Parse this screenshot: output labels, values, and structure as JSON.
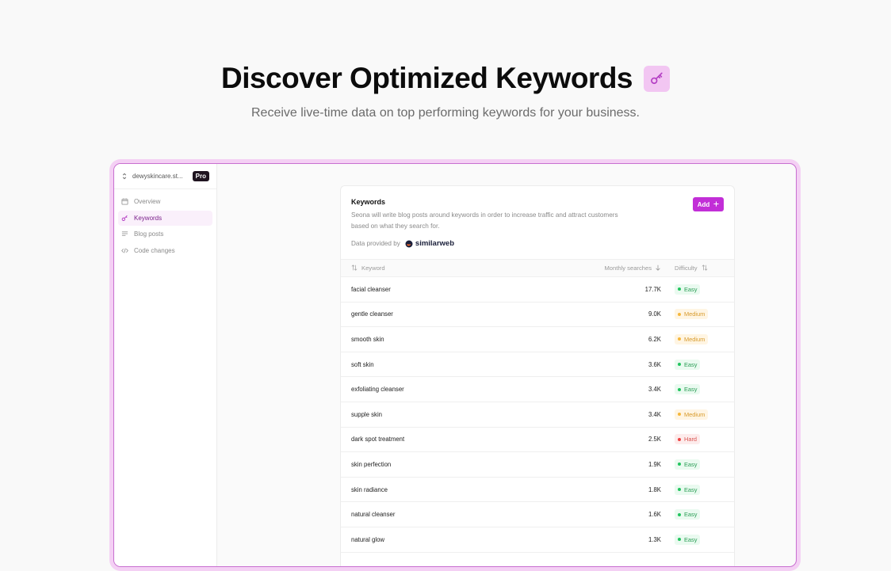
{
  "hero": {
    "title": "Discover Optimized Keywords",
    "subtitle": "Receive live-time data on top performing keywords for your business."
  },
  "sidebar": {
    "workspace": "dewyskincare.st...",
    "plan_badge": "Pro",
    "items": [
      {
        "label": "Overview",
        "icon": "calendar-icon"
      },
      {
        "label": "Keywords",
        "icon": "key-icon",
        "active": true
      },
      {
        "label": "Blog posts",
        "icon": "list-icon"
      },
      {
        "label": "Code changes",
        "icon": "code-icon"
      }
    ]
  },
  "card": {
    "title": "Keywords",
    "description": "Seona will write blog posts around keywords in order to increase traffic and attract customers based on what they search for.",
    "provided_by": "Data provided by",
    "provider": "similarweb",
    "add_label": "Add"
  },
  "table": {
    "columns": {
      "keyword": "Keyword",
      "searches": "Monthly searches",
      "difficulty": "Difficulty"
    },
    "rows": [
      {
        "keyword": "facial cleanser",
        "searches": "17.7K",
        "difficulty": "Easy"
      },
      {
        "keyword": "gentle cleanser",
        "searches": "9.0K",
        "difficulty": "Medium"
      },
      {
        "keyword": "smooth skin",
        "searches": "6.2K",
        "difficulty": "Medium"
      },
      {
        "keyword": "soft skin",
        "searches": "3.6K",
        "difficulty": "Easy"
      },
      {
        "keyword": "exfoliating cleanser",
        "searches": "3.4K",
        "difficulty": "Easy"
      },
      {
        "keyword": "supple skin",
        "searches": "3.4K",
        "difficulty": "Medium"
      },
      {
        "keyword": "dark spot treatment",
        "searches": "2.5K",
        "difficulty": "Hard"
      },
      {
        "keyword": "skin perfection",
        "searches": "1.9K",
        "difficulty": "Easy"
      },
      {
        "keyword": "skin radiance",
        "searches": "1.8K",
        "difficulty": "Easy"
      },
      {
        "keyword": "natural cleanser",
        "searches": "1.6K",
        "difficulty": "Easy"
      },
      {
        "keyword": "natural glow",
        "searches": "1.3K",
        "difficulty": "Easy"
      }
    ]
  },
  "colors": {
    "accent": "#c22ed7",
    "easy_bg": "#eafaf0",
    "easy_fg": "#2a9d55",
    "easy_dot": "#22c55e",
    "medium_bg": "#fff5e3",
    "medium_fg": "#d79a2b",
    "medium_dot": "#f5b73b",
    "hard_bg": "#fdecec",
    "hard_fg": "#d9534f",
    "hard_dot": "#ef4444"
  }
}
